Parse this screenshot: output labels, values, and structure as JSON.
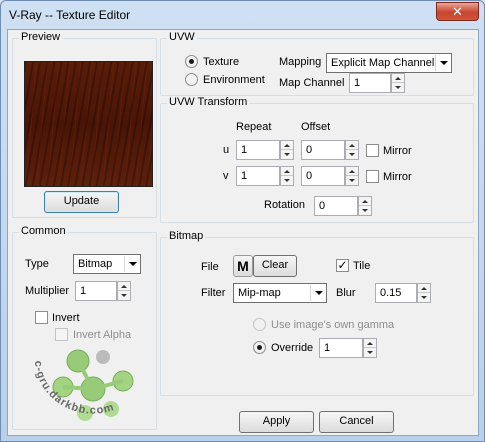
{
  "window": {
    "title": "V-Ray -- Texture Editor",
    "close_glyph": "✕"
  },
  "preview": {
    "group_label": "Preview",
    "update_label": "Update"
  },
  "uvw": {
    "group_label": "UVW",
    "texture_label": "Texture",
    "environment_label": "Environment",
    "selected": "texture",
    "mapping_label": "Mapping",
    "mapping_value": "Explicit Map Channel",
    "map_channel_label": "Map Channel",
    "map_channel_value": "1"
  },
  "uvw_transform": {
    "group_label": "UVW Transform",
    "repeat_label": "Repeat",
    "offset_label": "Offset",
    "u_label": "u",
    "v_label": "v",
    "u_repeat": "1",
    "u_offset": "0",
    "v_repeat": "1",
    "v_offset": "0",
    "mirror_label": "Mirror",
    "rotation_label": "Rotation",
    "rotation_value": "0"
  },
  "common": {
    "group_label": "Common",
    "type_label": "Type",
    "type_value": "Bitmap",
    "multiplier_label": "Multiplier",
    "multiplier_value": "1",
    "invert_label": "Invert",
    "invert_alpha_label": "Invert Alpha"
  },
  "bitmap": {
    "group_label": "Bitmap",
    "file_label": "File",
    "file_button_label": "M",
    "clear_label": "Clear",
    "tile_label": "Tile",
    "tile_checked_glyph": "✓",
    "filter_label": "Filter",
    "filter_value": "Mip-map",
    "blur_label": "Blur",
    "blur_value": "0.15",
    "own_gamma_label": "Use image's own gamma",
    "override_label": "Override",
    "override_value": "1"
  },
  "footer": {
    "apply_label": "Apply",
    "cancel_label": "Cancel"
  },
  "watermark": {
    "text": "c-gru.darkbb.com"
  },
  "colors": {
    "title_bar": "#cfe0f3",
    "close_button": "#c7442e",
    "preview_texture": "#4a1506",
    "watermark_green": "#8fc76a"
  }
}
